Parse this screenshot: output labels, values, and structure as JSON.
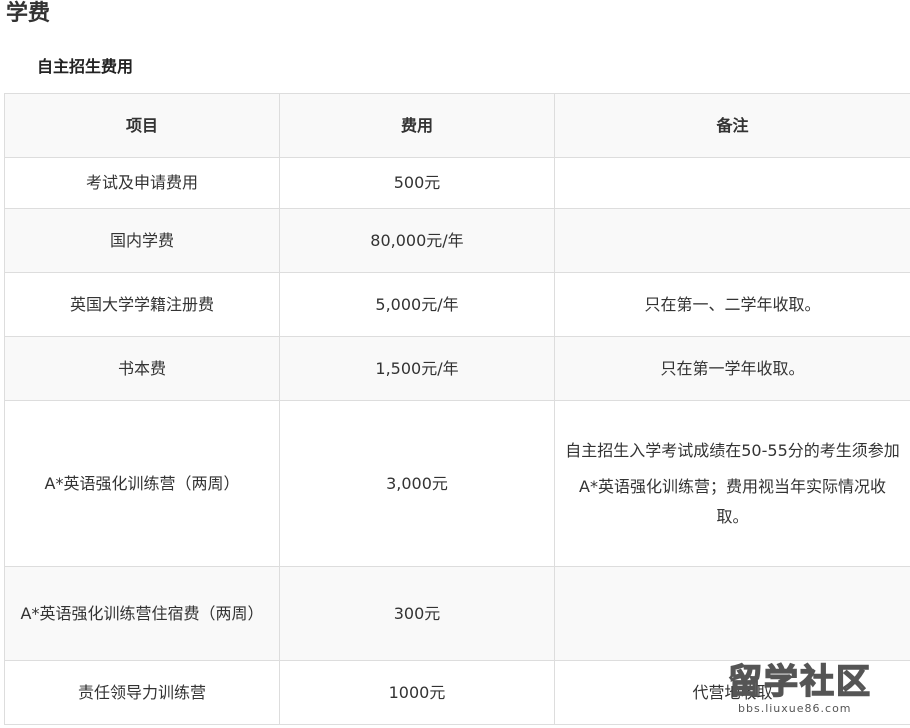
{
  "page": {
    "title": "学费"
  },
  "section": {
    "title": "自主招生费用"
  },
  "table": {
    "headers": [
      "项目",
      "费用",
      "备注"
    ],
    "rows": [
      {
        "item": "考试及申请费用",
        "fee": "500元",
        "notes": []
      },
      {
        "item": "国内学费",
        "fee": "80,000元/年",
        "notes": []
      },
      {
        "item": "英国大学学籍注册费",
        "fee": "5,000元/年",
        "notes": [
          "只在第一、二学年收取。"
        ]
      },
      {
        "item": "书本费",
        "fee": "1,500元/年",
        "notes": [
          "只在第一学年收取。"
        ]
      },
      {
        "item": "A*英语强化训练营（两周）",
        "fee": "3,000元",
        "notes": [
          "自主招生入学考试成绩在50-55分的考生须参加",
          "A*英语强化训练营；费用视当年实际情况收取。"
        ]
      },
      {
        "item": "A*英语强化训练营住宿费（两周）",
        "fee": "300元",
        "notes": []
      },
      {
        "item": "责任领导力训练营",
        "fee": "1000元",
        "notes": [
          "代营地收取"
        ]
      }
    ]
  },
  "watermark": {
    "main": "留学社区",
    "sub": "bbs.liuxue86.com"
  }
}
